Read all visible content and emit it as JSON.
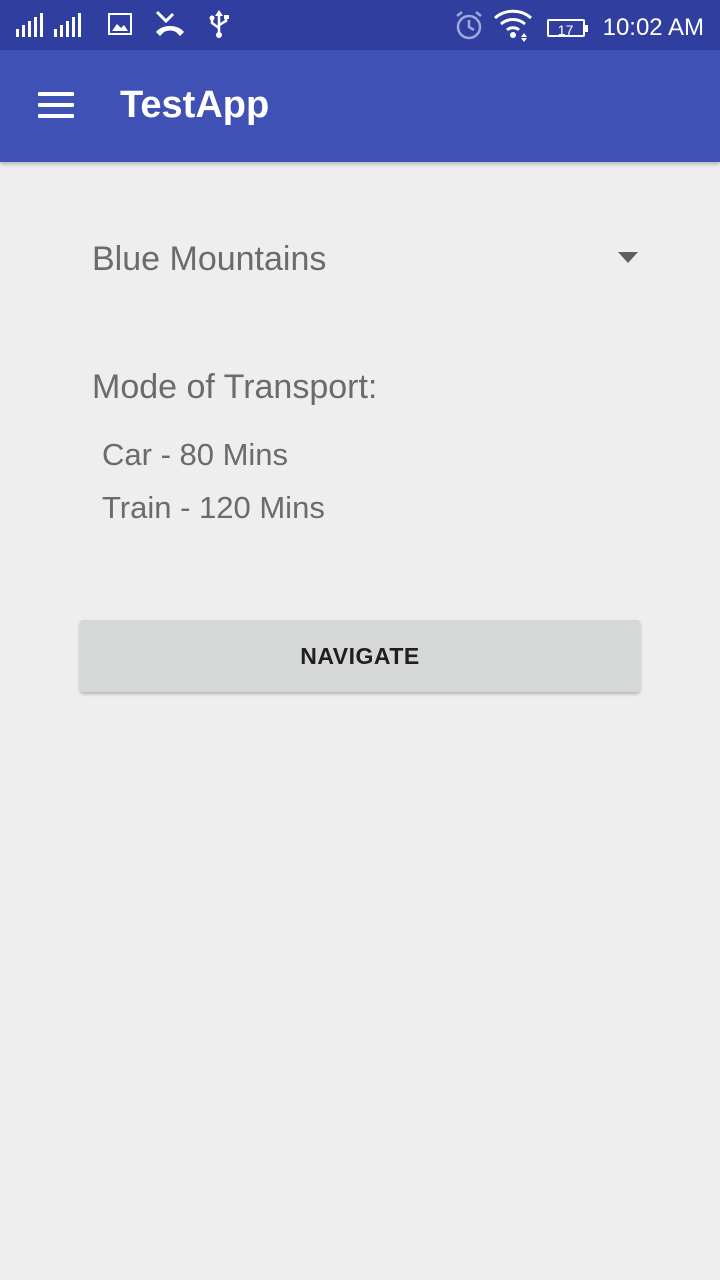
{
  "status_bar": {
    "time": "10:02 AM",
    "battery_level": "17",
    "icons": [
      "signal-icon",
      "image-icon",
      "missed-call-icon",
      "usb-icon",
      "alarm-icon",
      "wifi-icon",
      "battery-icon"
    ]
  },
  "app_bar": {
    "title": "TestApp",
    "menu_icon": "hamburger-menu-icon",
    "color": "#3f51b5",
    "status_color": "#303f9f"
  },
  "destination_spinner": {
    "selected": "Blue Mountains"
  },
  "transport": {
    "label": "Mode of Transport:",
    "items": [
      {
        "text": "Car - 80 Mins"
      },
      {
        "text": "Train - 120 Mins"
      }
    ]
  },
  "navigate_button": {
    "label": "NAVIGATE"
  }
}
